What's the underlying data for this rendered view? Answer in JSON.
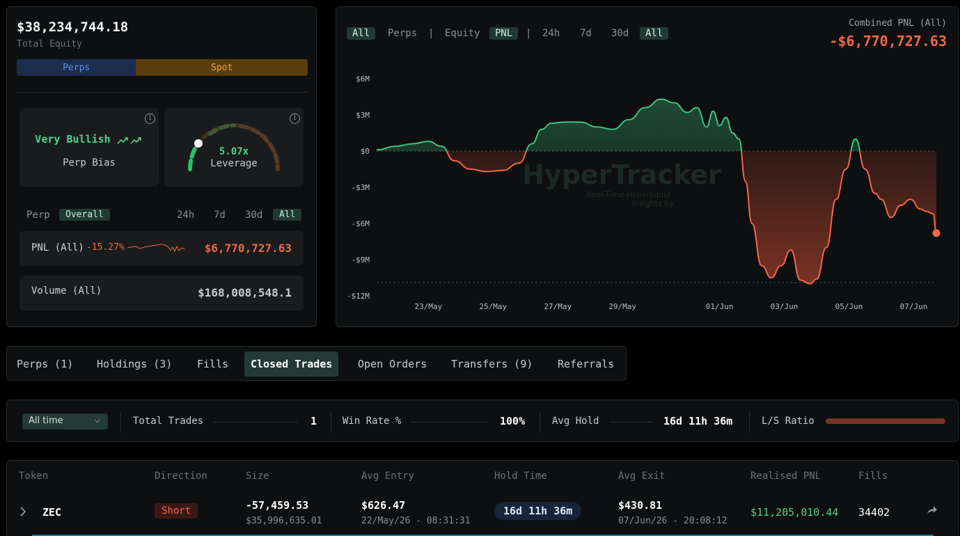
{
  "overview": {
    "total_equity": "$38,234,744.18",
    "total_equity_label": "Total Equity",
    "split": {
      "perps_label": "Perps",
      "spot_label": "Spot",
      "perps_share": 0.41
    },
    "bias": {
      "value": "Very Bullish",
      "label": "Perp Bias"
    },
    "leverage": {
      "value": "5.07x",
      "label": "Leverage"
    },
    "filters": {
      "perp": "Perp",
      "overall": "Overall",
      "tf": [
        "24h",
        "7d",
        "30d",
        "All"
      ]
    },
    "pnl_row": {
      "label": "PNL (All)",
      "pct": "-15.27%",
      "value": "$6,770,727.63"
    },
    "volume_row": {
      "label": "Volume (All)",
      "value": "$168,008,548.1"
    }
  },
  "chart_panel": {
    "filters": [
      "All",
      "Perps",
      "|",
      "Equity",
      "PNL",
      "|",
      "24h",
      "7d",
      "30d",
      "All"
    ],
    "combined_label": "Combined PNL (All)",
    "combined_value": "-$6,770,727.63",
    "watermark": "HyperTracker",
    "watermark_sub1": "Real-Time Hyperliquid",
    "watermark_sub2": "insights by"
  },
  "chart_data": {
    "type": "area",
    "y_ticks": [
      "$6M",
      "$3M",
      "$0",
      "-$3M",
      "-$6M",
      "-$9M",
      "-$12M"
    ],
    "x_ticks": [
      "23/May",
      "25/May",
      "27/May",
      "29/May",
      "01/Jun",
      "03/Jun",
      "05/Jun",
      "07/Jun"
    ],
    "ylim": [
      -12,
      6
    ],
    "unit": "$M",
    "x": [
      21.4,
      22.0,
      22.5,
      23.0,
      23.4,
      23.8,
      24.3,
      24.8,
      25.3,
      25.8,
      26.2,
      26.5,
      26.8,
      27.2,
      27.7,
      28.2,
      28.7,
      29.2,
      29.7,
      30.2,
      30.6,
      31.0,
      31.3,
      31.6,
      31.8,
      32.0,
      32.2,
      32.4,
      32.6,
      32.8,
      33.0,
      33.3,
      33.6,
      33.9,
      34.2,
      34.5,
      34.8,
      35.0,
      35.3,
      35.6,
      35.9,
      36.2,
      36.5,
      36.8,
      37.0,
      37.3,
      37.6,
      37.9,
      38.2,
      38.4,
      38.6,
      38.7
    ],
    "y": [
      0.1,
      0.4,
      0.6,
      0.8,
      0.4,
      -0.8,
      -1.5,
      -1.7,
      -1.6,
      -1.0,
      0.6,
      1.8,
      2.3,
      2.4,
      2.4,
      2.0,
      1.8,
      2.6,
      3.6,
      4.3,
      4.0,
      3.2,
      3.6,
      2.0,
      3.3,
      2.1,
      2.8,
      1.5,
      1.0,
      -2.5,
      -6.0,
      -9.5,
      -10.5,
      -9.5,
      -8.2,
      -10.7,
      -11.0,
      -10.6,
      -8.0,
      -4.0,
      -1.5,
      1.0,
      -1.5,
      -3.5,
      -4.0,
      -5.5,
      -4.5,
      -4.0,
      -4.8,
      -5.0,
      -5.2,
      -6.8
    ],
    "zero_line": 0,
    "min_line": -10.9
  },
  "tabs": [
    "Perps (1)",
    "Holdings (3)",
    "Fills",
    "Closed Trades",
    "Open Orders",
    "Transfers (9)",
    "Referrals"
  ],
  "active_tab": "Closed Trades",
  "stats": {
    "period": "All time",
    "total_trades_label": "Total Trades",
    "total_trades": "1",
    "win_rate_label": "Win Rate %",
    "win_rate": "100%",
    "avg_hold_label": "Avg Hold",
    "avg_hold": "16d 11h 36m",
    "ls_label": "L/S Ratio"
  },
  "table": {
    "headers": [
      "Token",
      "Direction",
      "Size",
      "Avg Entry",
      "Hold Time",
      "Avg Exit",
      "Realised PNL",
      "Fills"
    ],
    "row": {
      "token": "ZEC",
      "direction": "Short",
      "size": "-57,459.53",
      "size_usd": "$35,996,635.01",
      "avg_entry": "$626.47",
      "entry_time": "22/May/26 - 08:31:31",
      "hold_time": "16d 11h 36m",
      "avg_exit": "$430.81",
      "exit_time": "07/Jun/26 - 20:08:12",
      "realised_pnl": "$11,205,010.44",
      "fills": "34402"
    }
  },
  "colors": {
    "green": "#4fd289",
    "red": "#f0674a",
    "accent_bg": "#1f3a33"
  }
}
